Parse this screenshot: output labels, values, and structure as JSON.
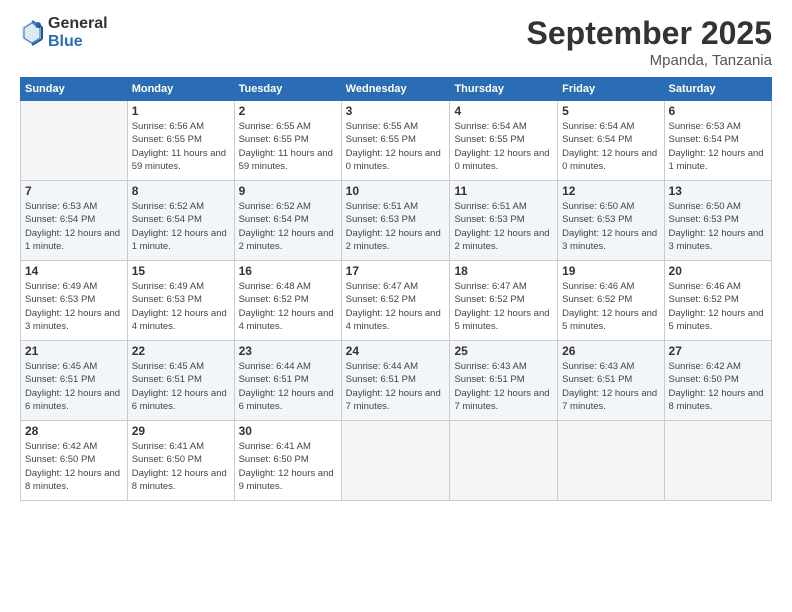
{
  "header": {
    "logo_general": "General",
    "logo_blue": "Blue",
    "month_title": "September 2025",
    "subtitle": "Mpanda, Tanzania"
  },
  "weekdays": [
    "Sunday",
    "Monday",
    "Tuesday",
    "Wednesday",
    "Thursday",
    "Friday",
    "Saturday"
  ],
  "weeks": [
    [
      {
        "day": "",
        "empty": true
      },
      {
        "day": "1",
        "sunrise": "6:56 AM",
        "sunset": "6:55 PM",
        "daylight": "11 hours and 59 minutes."
      },
      {
        "day": "2",
        "sunrise": "6:55 AM",
        "sunset": "6:55 PM",
        "daylight": "11 hours and 59 minutes."
      },
      {
        "day": "3",
        "sunrise": "6:55 AM",
        "sunset": "6:55 PM",
        "daylight": "12 hours and 0 minutes."
      },
      {
        "day": "4",
        "sunrise": "6:54 AM",
        "sunset": "6:55 PM",
        "daylight": "12 hours and 0 minutes."
      },
      {
        "day": "5",
        "sunrise": "6:54 AM",
        "sunset": "6:54 PM",
        "daylight": "12 hours and 0 minutes."
      },
      {
        "day": "6",
        "sunrise": "6:53 AM",
        "sunset": "6:54 PM",
        "daylight": "12 hours and 1 minute."
      }
    ],
    [
      {
        "day": "7",
        "sunrise": "6:53 AM",
        "sunset": "6:54 PM",
        "daylight": "12 hours and 1 minute."
      },
      {
        "day": "8",
        "sunrise": "6:52 AM",
        "sunset": "6:54 PM",
        "daylight": "12 hours and 1 minute."
      },
      {
        "day": "9",
        "sunrise": "6:52 AM",
        "sunset": "6:54 PM",
        "daylight": "12 hours and 2 minutes."
      },
      {
        "day": "10",
        "sunrise": "6:51 AM",
        "sunset": "6:53 PM",
        "daylight": "12 hours and 2 minutes."
      },
      {
        "day": "11",
        "sunrise": "6:51 AM",
        "sunset": "6:53 PM",
        "daylight": "12 hours and 2 minutes."
      },
      {
        "day": "12",
        "sunrise": "6:50 AM",
        "sunset": "6:53 PM",
        "daylight": "12 hours and 3 minutes."
      },
      {
        "day": "13",
        "sunrise": "6:50 AM",
        "sunset": "6:53 PM",
        "daylight": "12 hours and 3 minutes."
      }
    ],
    [
      {
        "day": "14",
        "sunrise": "6:49 AM",
        "sunset": "6:53 PM",
        "daylight": "12 hours and 3 minutes."
      },
      {
        "day": "15",
        "sunrise": "6:49 AM",
        "sunset": "6:53 PM",
        "daylight": "12 hours and 4 minutes."
      },
      {
        "day": "16",
        "sunrise": "6:48 AM",
        "sunset": "6:52 PM",
        "daylight": "12 hours and 4 minutes."
      },
      {
        "day": "17",
        "sunrise": "6:47 AM",
        "sunset": "6:52 PM",
        "daylight": "12 hours and 4 minutes."
      },
      {
        "day": "18",
        "sunrise": "6:47 AM",
        "sunset": "6:52 PM",
        "daylight": "12 hours and 5 minutes."
      },
      {
        "day": "19",
        "sunrise": "6:46 AM",
        "sunset": "6:52 PM",
        "daylight": "12 hours and 5 minutes."
      },
      {
        "day": "20",
        "sunrise": "6:46 AM",
        "sunset": "6:52 PM",
        "daylight": "12 hours and 5 minutes."
      }
    ],
    [
      {
        "day": "21",
        "sunrise": "6:45 AM",
        "sunset": "6:51 PM",
        "daylight": "12 hours and 6 minutes."
      },
      {
        "day": "22",
        "sunrise": "6:45 AM",
        "sunset": "6:51 PM",
        "daylight": "12 hours and 6 minutes."
      },
      {
        "day": "23",
        "sunrise": "6:44 AM",
        "sunset": "6:51 PM",
        "daylight": "12 hours and 6 minutes."
      },
      {
        "day": "24",
        "sunrise": "6:44 AM",
        "sunset": "6:51 PM",
        "daylight": "12 hours and 7 minutes."
      },
      {
        "day": "25",
        "sunrise": "6:43 AM",
        "sunset": "6:51 PM",
        "daylight": "12 hours and 7 minutes."
      },
      {
        "day": "26",
        "sunrise": "6:43 AM",
        "sunset": "6:51 PM",
        "daylight": "12 hours and 7 minutes."
      },
      {
        "day": "27",
        "sunrise": "6:42 AM",
        "sunset": "6:50 PM",
        "daylight": "12 hours and 8 minutes."
      }
    ],
    [
      {
        "day": "28",
        "sunrise": "6:42 AM",
        "sunset": "6:50 PM",
        "daylight": "12 hours and 8 minutes."
      },
      {
        "day": "29",
        "sunrise": "6:41 AM",
        "sunset": "6:50 PM",
        "daylight": "12 hours and 8 minutes."
      },
      {
        "day": "30",
        "sunrise": "6:41 AM",
        "sunset": "6:50 PM",
        "daylight": "12 hours and 9 minutes."
      },
      {
        "day": "",
        "empty": true
      },
      {
        "day": "",
        "empty": true
      },
      {
        "day": "",
        "empty": true
      },
      {
        "day": "",
        "empty": true
      }
    ]
  ]
}
